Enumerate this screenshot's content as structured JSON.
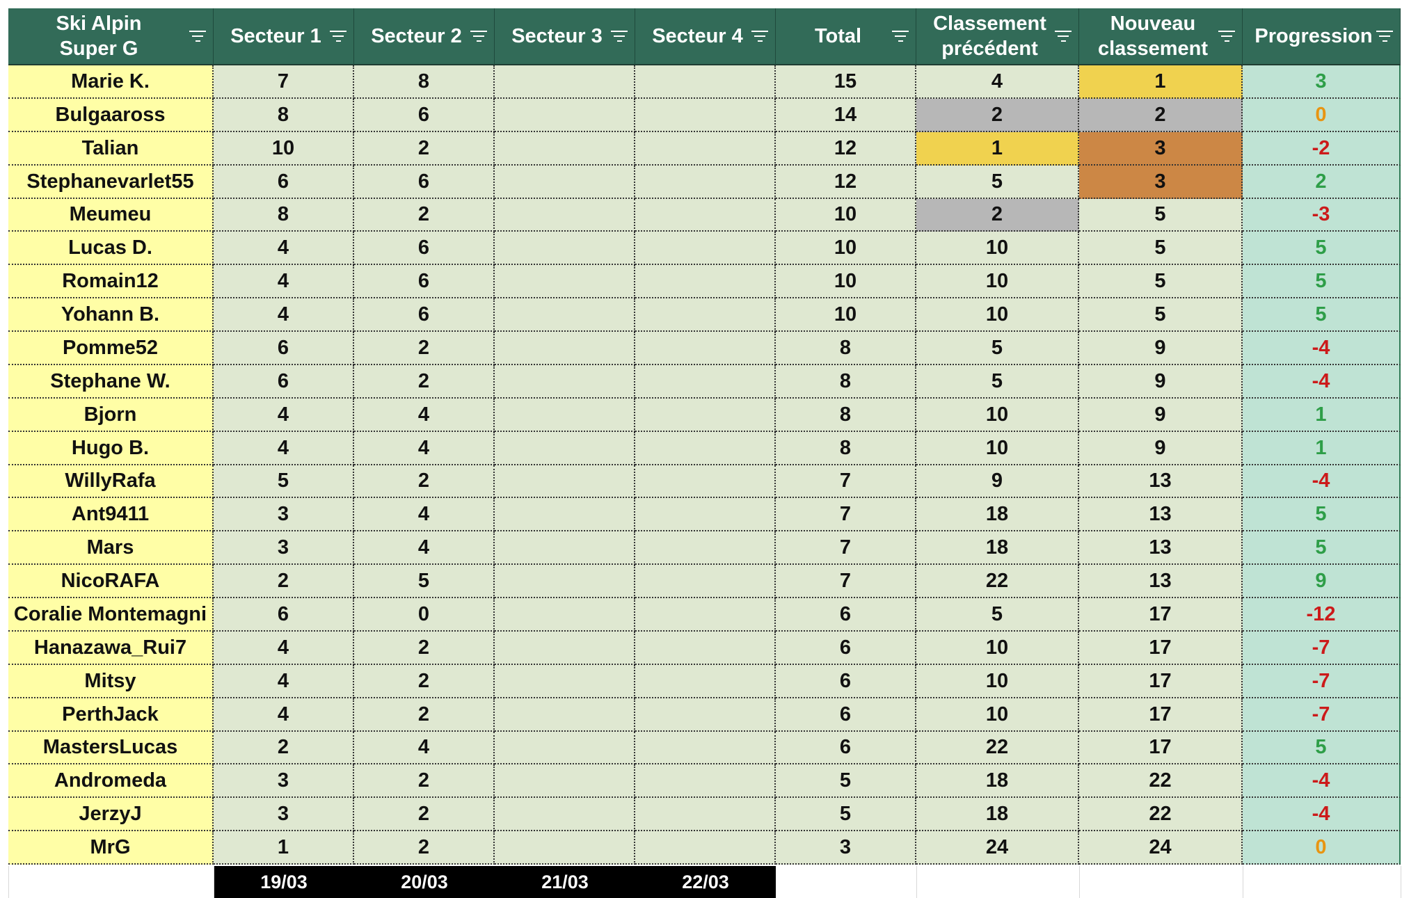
{
  "columns": [
    {
      "label": "Ski Alpin\nSuper G"
    },
    {
      "label": "Secteur 1"
    },
    {
      "label": "Secteur 2"
    },
    {
      "label": "Secteur 3"
    },
    {
      "label": "Secteur 4"
    },
    {
      "label": "Total"
    },
    {
      "label": "Classement\nprécédent"
    },
    {
      "label": "Nouveau\nclassement"
    },
    {
      "label": "Progression"
    }
  ],
  "rows": [
    {
      "name": "Marie K.",
      "s1": "7",
      "s2": "8",
      "s3": "",
      "s4": "",
      "total": "15",
      "prev": "4",
      "new": "1",
      "prog": "3",
      "prev_medal": "",
      "new_medal": "gold"
    },
    {
      "name": "Bulgaaross",
      "s1": "8",
      "s2": "6",
      "s3": "",
      "s4": "",
      "total": "14",
      "prev": "2",
      "new": "2",
      "prog": "0",
      "prev_medal": "silver",
      "new_medal": "silver"
    },
    {
      "name": "Talian",
      "s1": "10",
      "s2": "2",
      "s3": "",
      "s4": "",
      "total": "12",
      "prev": "1",
      "new": "3",
      "prog": "-2",
      "prev_medal": "gold",
      "new_medal": "bronze"
    },
    {
      "name": "Stephanevarlet55",
      "s1": "6",
      "s2": "6",
      "s3": "",
      "s4": "",
      "total": "12",
      "prev": "5",
      "new": "3",
      "prog": "2",
      "prev_medal": "",
      "new_medal": "bronze"
    },
    {
      "name": "Meumeu",
      "s1": "8",
      "s2": "2",
      "s3": "",
      "s4": "",
      "total": "10",
      "prev": "2",
      "new": "5",
      "prog": "-3",
      "prev_medal": "silver",
      "new_medal": ""
    },
    {
      "name": "Lucas D.",
      "s1": "4",
      "s2": "6",
      "s3": "",
      "s4": "",
      "total": "10",
      "prev": "10",
      "new": "5",
      "prog": "5",
      "prev_medal": "",
      "new_medal": ""
    },
    {
      "name": "Romain12",
      "s1": "4",
      "s2": "6",
      "s3": "",
      "s4": "",
      "total": "10",
      "prev": "10",
      "new": "5",
      "prog": "5",
      "prev_medal": "",
      "new_medal": ""
    },
    {
      "name": "Yohann B.",
      "s1": "4",
      "s2": "6",
      "s3": "",
      "s4": "",
      "total": "10",
      "prev": "10",
      "new": "5",
      "prog": "5",
      "prev_medal": "",
      "new_medal": ""
    },
    {
      "name": "Pomme52",
      "s1": "6",
      "s2": "2",
      "s3": "",
      "s4": "",
      "total": "8",
      "prev": "5",
      "new": "9",
      "prog": "-4",
      "prev_medal": "",
      "new_medal": ""
    },
    {
      "name": "Stephane W.",
      "s1": "6",
      "s2": "2",
      "s3": "",
      "s4": "",
      "total": "8",
      "prev": "5",
      "new": "9",
      "prog": "-4",
      "prev_medal": "",
      "new_medal": ""
    },
    {
      "name": "Bjorn",
      "s1": "4",
      "s2": "4",
      "s3": "",
      "s4": "",
      "total": "8",
      "prev": "10",
      "new": "9",
      "prog": "1",
      "prev_medal": "",
      "new_medal": ""
    },
    {
      "name": "Hugo B.",
      "s1": "4",
      "s2": "4",
      "s3": "",
      "s4": "",
      "total": "8",
      "prev": "10",
      "new": "9",
      "prog": "1",
      "prev_medal": "",
      "new_medal": ""
    },
    {
      "name": "WillyRafa",
      "s1": "5",
      "s2": "2",
      "s3": "",
      "s4": "",
      "total": "7",
      "prev": "9",
      "new": "13",
      "prog": "-4",
      "prev_medal": "",
      "new_medal": ""
    },
    {
      "name": "Ant9411",
      "s1": "3",
      "s2": "4",
      "s3": "",
      "s4": "",
      "total": "7",
      "prev": "18",
      "new": "13",
      "prog": "5",
      "prev_medal": "",
      "new_medal": ""
    },
    {
      "name": "Mars",
      "s1": "3",
      "s2": "4",
      "s3": "",
      "s4": "",
      "total": "7",
      "prev": "18",
      "new": "13",
      "prog": "5",
      "prev_medal": "",
      "new_medal": ""
    },
    {
      "name": "NicoRAFA",
      "s1": "2",
      "s2": "5",
      "s3": "",
      "s4": "",
      "total": "7",
      "prev": "22",
      "new": "13",
      "prog": "9",
      "prev_medal": "",
      "new_medal": ""
    },
    {
      "name": "Coralie Montemagni",
      "s1": "6",
      "s2": "0",
      "s3": "",
      "s4": "",
      "total": "6",
      "prev": "5",
      "new": "17",
      "prog": "-12",
      "prev_medal": "",
      "new_medal": ""
    },
    {
      "name": "Hanazawa_Rui7",
      "s1": "4",
      "s2": "2",
      "s3": "",
      "s4": "",
      "total": "6",
      "prev": "10",
      "new": "17",
      "prog": "-7",
      "prev_medal": "",
      "new_medal": ""
    },
    {
      "name": "Mitsy",
      "s1": "4",
      "s2": "2",
      "s3": "",
      "s4": "",
      "total": "6",
      "prev": "10",
      "new": "17",
      "prog": "-7",
      "prev_medal": "",
      "new_medal": ""
    },
    {
      "name": "PerthJack",
      "s1": "4",
      "s2": "2",
      "s3": "",
      "s4": "",
      "total": "6",
      "prev": "10",
      "new": "17",
      "prog": "-7",
      "prev_medal": "",
      "new_medal": ""
    },
    {
      "name": "MastersLucas",
      "s1": "2",
      "s2": "4",
      "s3": "",
      "s4": "",
      "total": "6",
      "prev": "22",
      "new": "17",
      "prog": "5",
      "prev_medal": "",
      "new_medal": ""
    },
    {
      "name": "Andromeda",
      "s1": "3",
      "s2": "2",
      "s3": "",
      "s4": "",
      "total": "5",
      "prev": "18",
      "new": "22",
      "prog": "-4",
      "prev_medal": "",
      "new_medal": ""
    },
    {
      "name": "JerzyJ",
      "s1": "3",
      "s2": "2",
      "s3": "",
      "s4": "",
      "total": "5",
      "prev": "18",
      "new": "22",
      "prog": "-4",
      "prev_medal": "",
      "new_medal": ""
    },
    {
      "name": "MrG",
      "s1": "1",
      "s2": "2",
      "s3": "",
      "s4": "",
      "total": "3",
      "prev": "24",
      "new": "24",
      "prog": "0",
      "prev_medal": "",
      "new_medal": ""
    }
  ],
  "dates": [
    "19/03",
    "20/03",
    "21/03",
    "22/03"
  ],
  "colors": {
    "header_bg": "#326b58",
    "name_bg": "#fffea6",
    "cell_bg": "#dfe8d1",
    "progression_bg": "#bfe3d4",
    "gold": "#f0d24f",
    "silver": "#b7b7b7",
    "bronze": "#cc8745",
    "positive": "#2e9e48",
    "negative": "#cc1a1a",
    "zero": "#e89512"
  },
  "icons": {
    "column_filter": "filter-icon"
  }
}
